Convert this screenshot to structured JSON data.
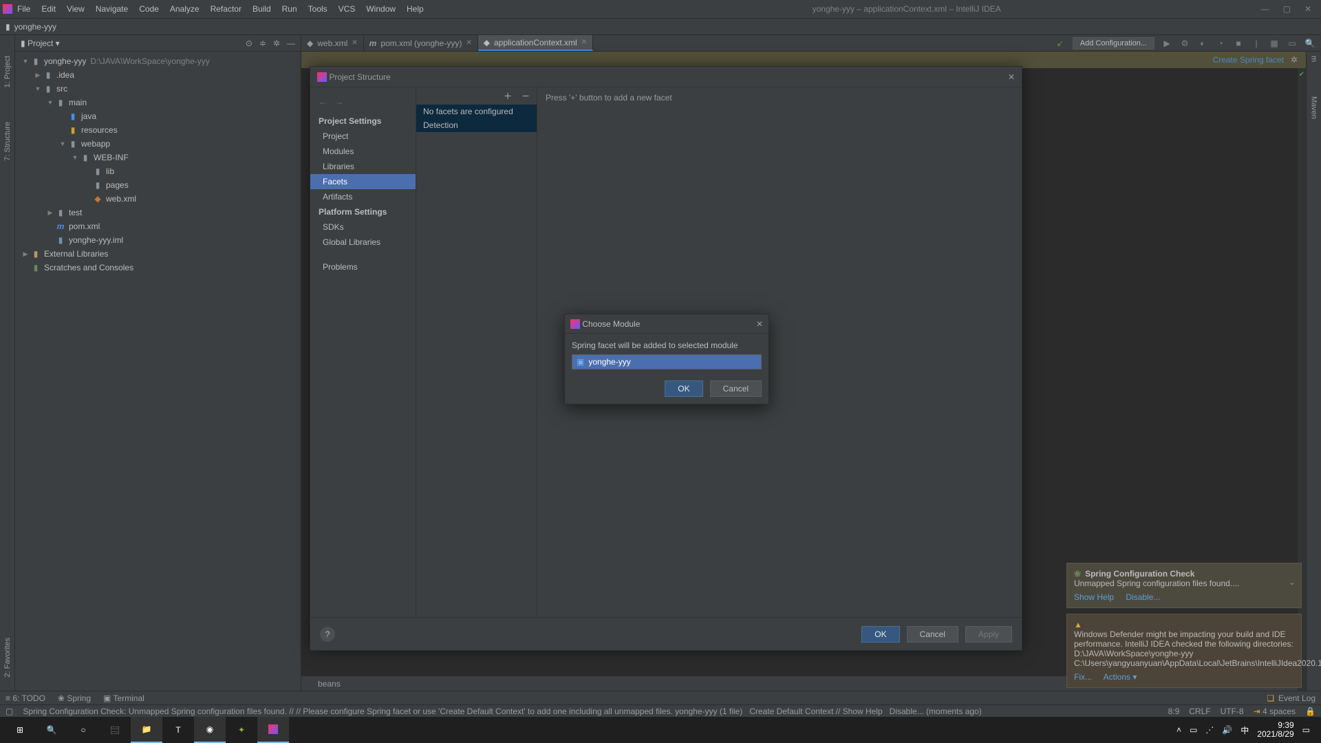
{
  "menubar": [
    "File",
    "Edit",
    "View",
    "Navigate",
    "Code",
    "Analyze",
    "Refactor",
    "Build",
    "Run",
    "Tools",
    "VCS",
    "Window",
    "Help"
  ],
  "window_title": "yonghe-yyy – applicationContext.xml – IntelliJ IDEA",
  "breadcrumb": {
    "project": "yonghe-yyy"
  },
  "project_panel": {
    "title": "Project",
    "root": {
      "name": "yonghe-yyy",
      "path": "D:\\JAVA\\WorkSpace\\yonghe-yyy"
    },
    "nodes": {
      "idea": ".idea",
      "src": "src",
      "main": "main",
      "java": "java",
      "resources": "resources",
      "webapp": "webapp",
      "webinf": "WEB-INF",
      "lib": "lib",
      "pages": "pages",
      "webxml": "web.xml",
      "test": "test",
      "pom": "pom.xml",
      "iml": "yonghe-yyy.iml",
      "extlib": "External Libraries",
      "scratches": "Scratches and Consoles"
    }
  },
  "tabs": [
    {
      "icon": "xml",
      "label": "web.xml",
      "active": false
    },
    {
      "icon": "m",
      "label": "pom.xml (yonghe-yyy)",
      "active": false
    },
    {
      "icon": "xml",
      "label": "applicationContext.xml",
      "active": true
    }
  ],
  "run_config": "Add Configuration...",
  "banner": {
    "link": "Create Spring facet"
  },
  "left_tools": {
    "project": "1: Project",
    "structure": "7: Structure",
    "favorites": "2: Favorites"
  },
  "right_tools": {
    "maven": "Maven",
    "m": "m"
  },
  "ps": {
    "title": "Project Structure",
    "sections": {
      "project_settings": "Project Settings",
      "project": "Project",
      "modules": "Modules",
      "libraries": "Libraries",
      "facets": "Facets",
      "artifacts": "Artifacts",
      "platform_settings": "Platform Settings",
      "sdks": "SDKs",
      "global_libraries": "Global Libraries",
      "problems": "Problems"
    },
    "mid": {
      "none": "No facets are configured",
      "detection": "Detection"
    },
    "hint": "Press '+' button to add a new facet",
    "buttons": {
      "ok": "OK",
      "cancel": "Cancel",
      "apply": "Apply"
    }
  },
  "cm": {
    "title": "Choose Module",
    "prompt": "Spring facet will be added to selected module",
    "module": "yonghe-yyy",
    "ok": "OK",
    "cancel": "Cancel"
  },
  "notifications": {
    "n1": {
      "title": "Spring Configuration Check",
      "body": "Unmapped Spring configuration files found....",
      "links": {
        "show_help": "Show Help",
        "disable": "Disable..."
      }
    },
    "n2": {
      "body": "Windows Defender might be impacting your build and IDE performance. IntelliJ IDEA checked the following directories:\nD:\\JAVA\\WorkSpace\\yonghe-yyy\nC:\\Users\\yangyuanyuan\\AppData\\Local\\JetBrains\\IntelliJIdea2020.1",
      "links": {
        "fix": "Fix...",
        "actions": "Actions ▾"
      }
    }
  },
  "beans_footer": "beans",
  "bottom_tools": {
    "todo": "6: TODO",
    "spring": "Spring",
    "terminal": "Terminal",
    "event_log": "Event Log"
  },
  "statusbar": {
    "msg": "Spring Configuration Check: Unmapped Spring configuration files found. // // Please configure Spring facet or use 'Create Default Context' to add one including all unmapped files. yonghe-yyy (1 file)",
    "links": {
      "create": "Create Default Context // Show Help",
      "disable": "Disable... (moments ago)"
    },
    "pos": "8:9",
    "eol": "CRLF",
    "enc": "UTF-8",
    "indent": "4 spaces"
  },
  "taskbar": {
    "time": "9:39",
    "date": "2021/8/29"
  }
}
